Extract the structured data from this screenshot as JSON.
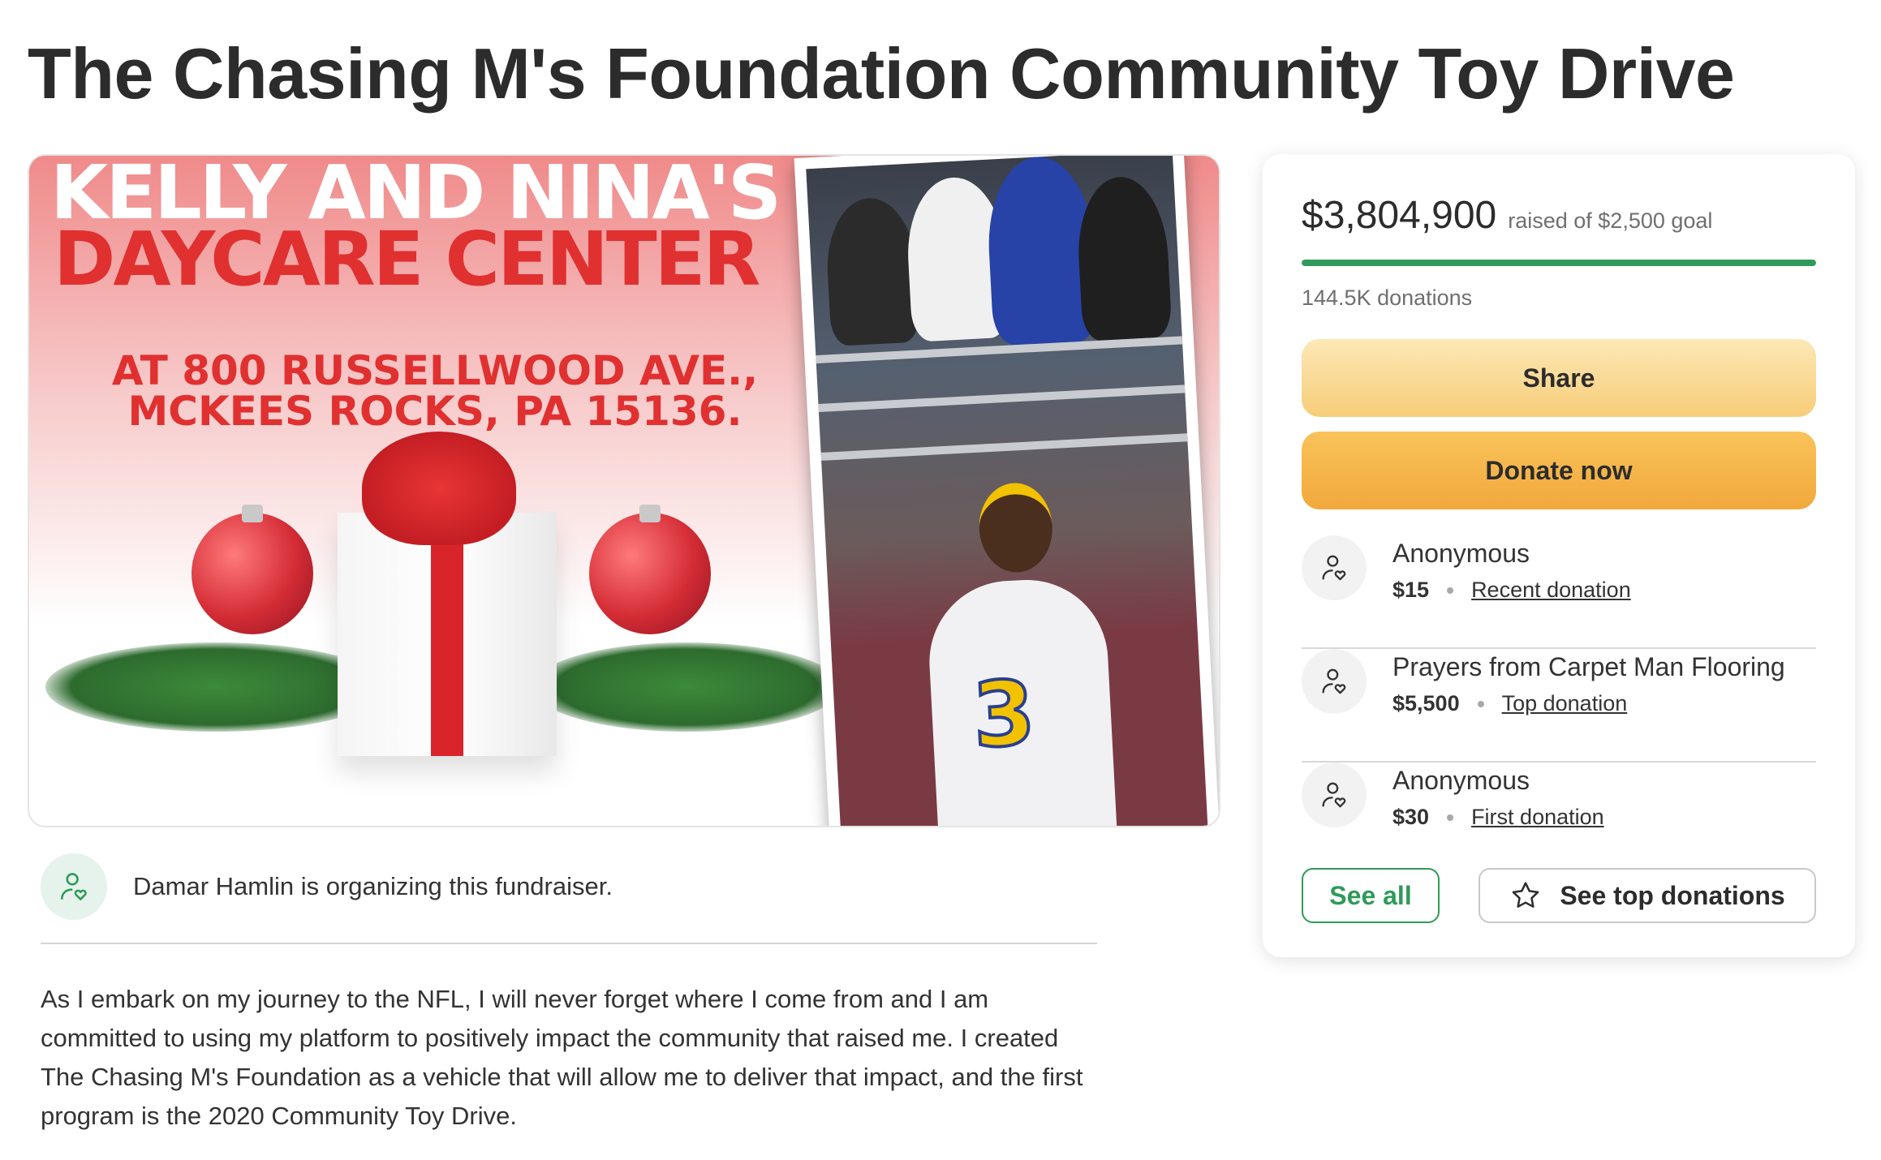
{
  "page": {
    "title": "The Chasing M's Foundation Community Toy Drive"
  },
  "hero": {
    "line1": "KELLY AND NINA'S",
    "line2": "DAYCARE CENTER",
    "address_line1": "AT 800 RUSSELLWOOD AVE.,",
    "address_line2": "MCKEES ROCKS, PA 15136.",
    "player_number": "3"
  },
  "organizer": {
    "text": "Damar Hamlin is organizing this fundraiser.",
    "icon": "user-heart-icon"
  },
  "story": {
    "text": "As I embark on my journey to the NFL, I will never forget where I come from and I am committed to using my platform to positively impact the community that raised me.  I created The Chasing M's Foundation as a vehicle that will allow me to deliver that impact, and the first program is the 2020 Community Toy Drive."
  },
  "donation_card": {
    "raised_amount": "$3,804,900",
    "goal_text": "raised of $2,500 goal",
    "progress_percent": 100,
    "donations_count": "144.5K donations",
    "share_label": "Share",
    "donate_label": "Donate now",
    "donors": [
      {
        "name": "Anonymous",
        "amount": "$15",
        "tag": "Recent donation"
      },
      {
        "name": "Prayers from Carpet Man Flooring",
        "amount": "$5,500",
        "tag": "Top donation"
      },
      {
        "name": "Anonymous",
        "amount": "$30",
        "tag": "First donation"
      }
    ],
    "see_all_label": "See all",
    "see_top_label": "See top donations",
    "see_top_icon": "star-icon"
  },
  "colors": {
    "accent_green": "#2f9a59",
    "share_button": "#f7cd79",
    "donate_button": "#f1a83c",
    "hero_red": "#e03030"
  }
}
